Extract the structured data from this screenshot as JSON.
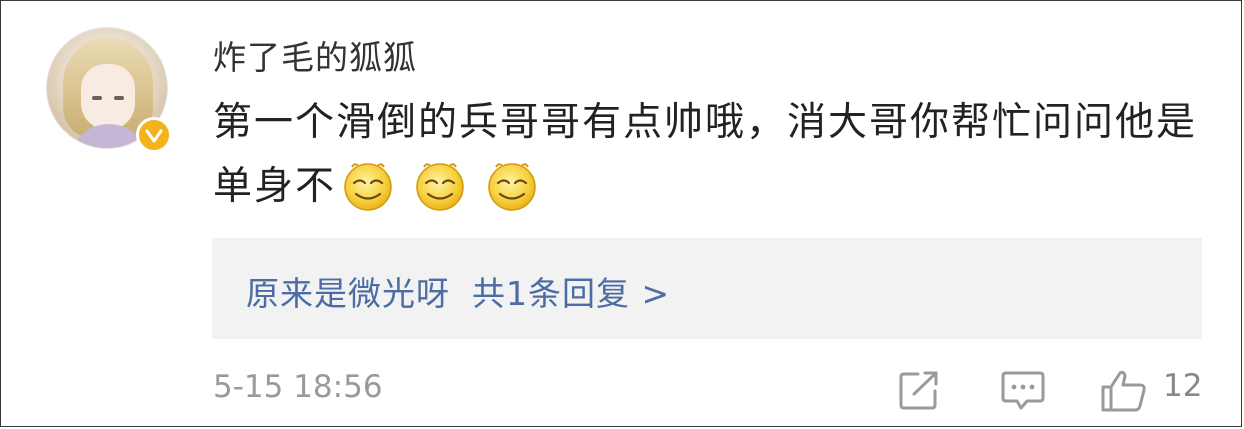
{
  "comment": {
    "username": "炸了毛的狐狐",
    "text": "第一个滑倒的兵哥哥有点帅哦，消大哥你帮忙问问他是单身不",
    "emojis": [
      "grin-emoji",
      "grin-emoji",
      "grin-emoji"
    ],
    "verified_badge_color": "#f5b31b",
    "time": "5-15 18:56",
    "like_count": "12"
  },
  "reply_preview": {
    "name": "原来是微光呀",
    "summary": "共1条回复 >"
  },
  "icons": {
    "share": "share-icon",
    "comment": "comment-icon",
    "like": "thumbs-up-icon"
  },
  "colors": {
    "link_blue": "#4c6da4",
    "reply_bg": "#f2f2f2",
    "meta_gray": "#9a9a9a"
  }
}
